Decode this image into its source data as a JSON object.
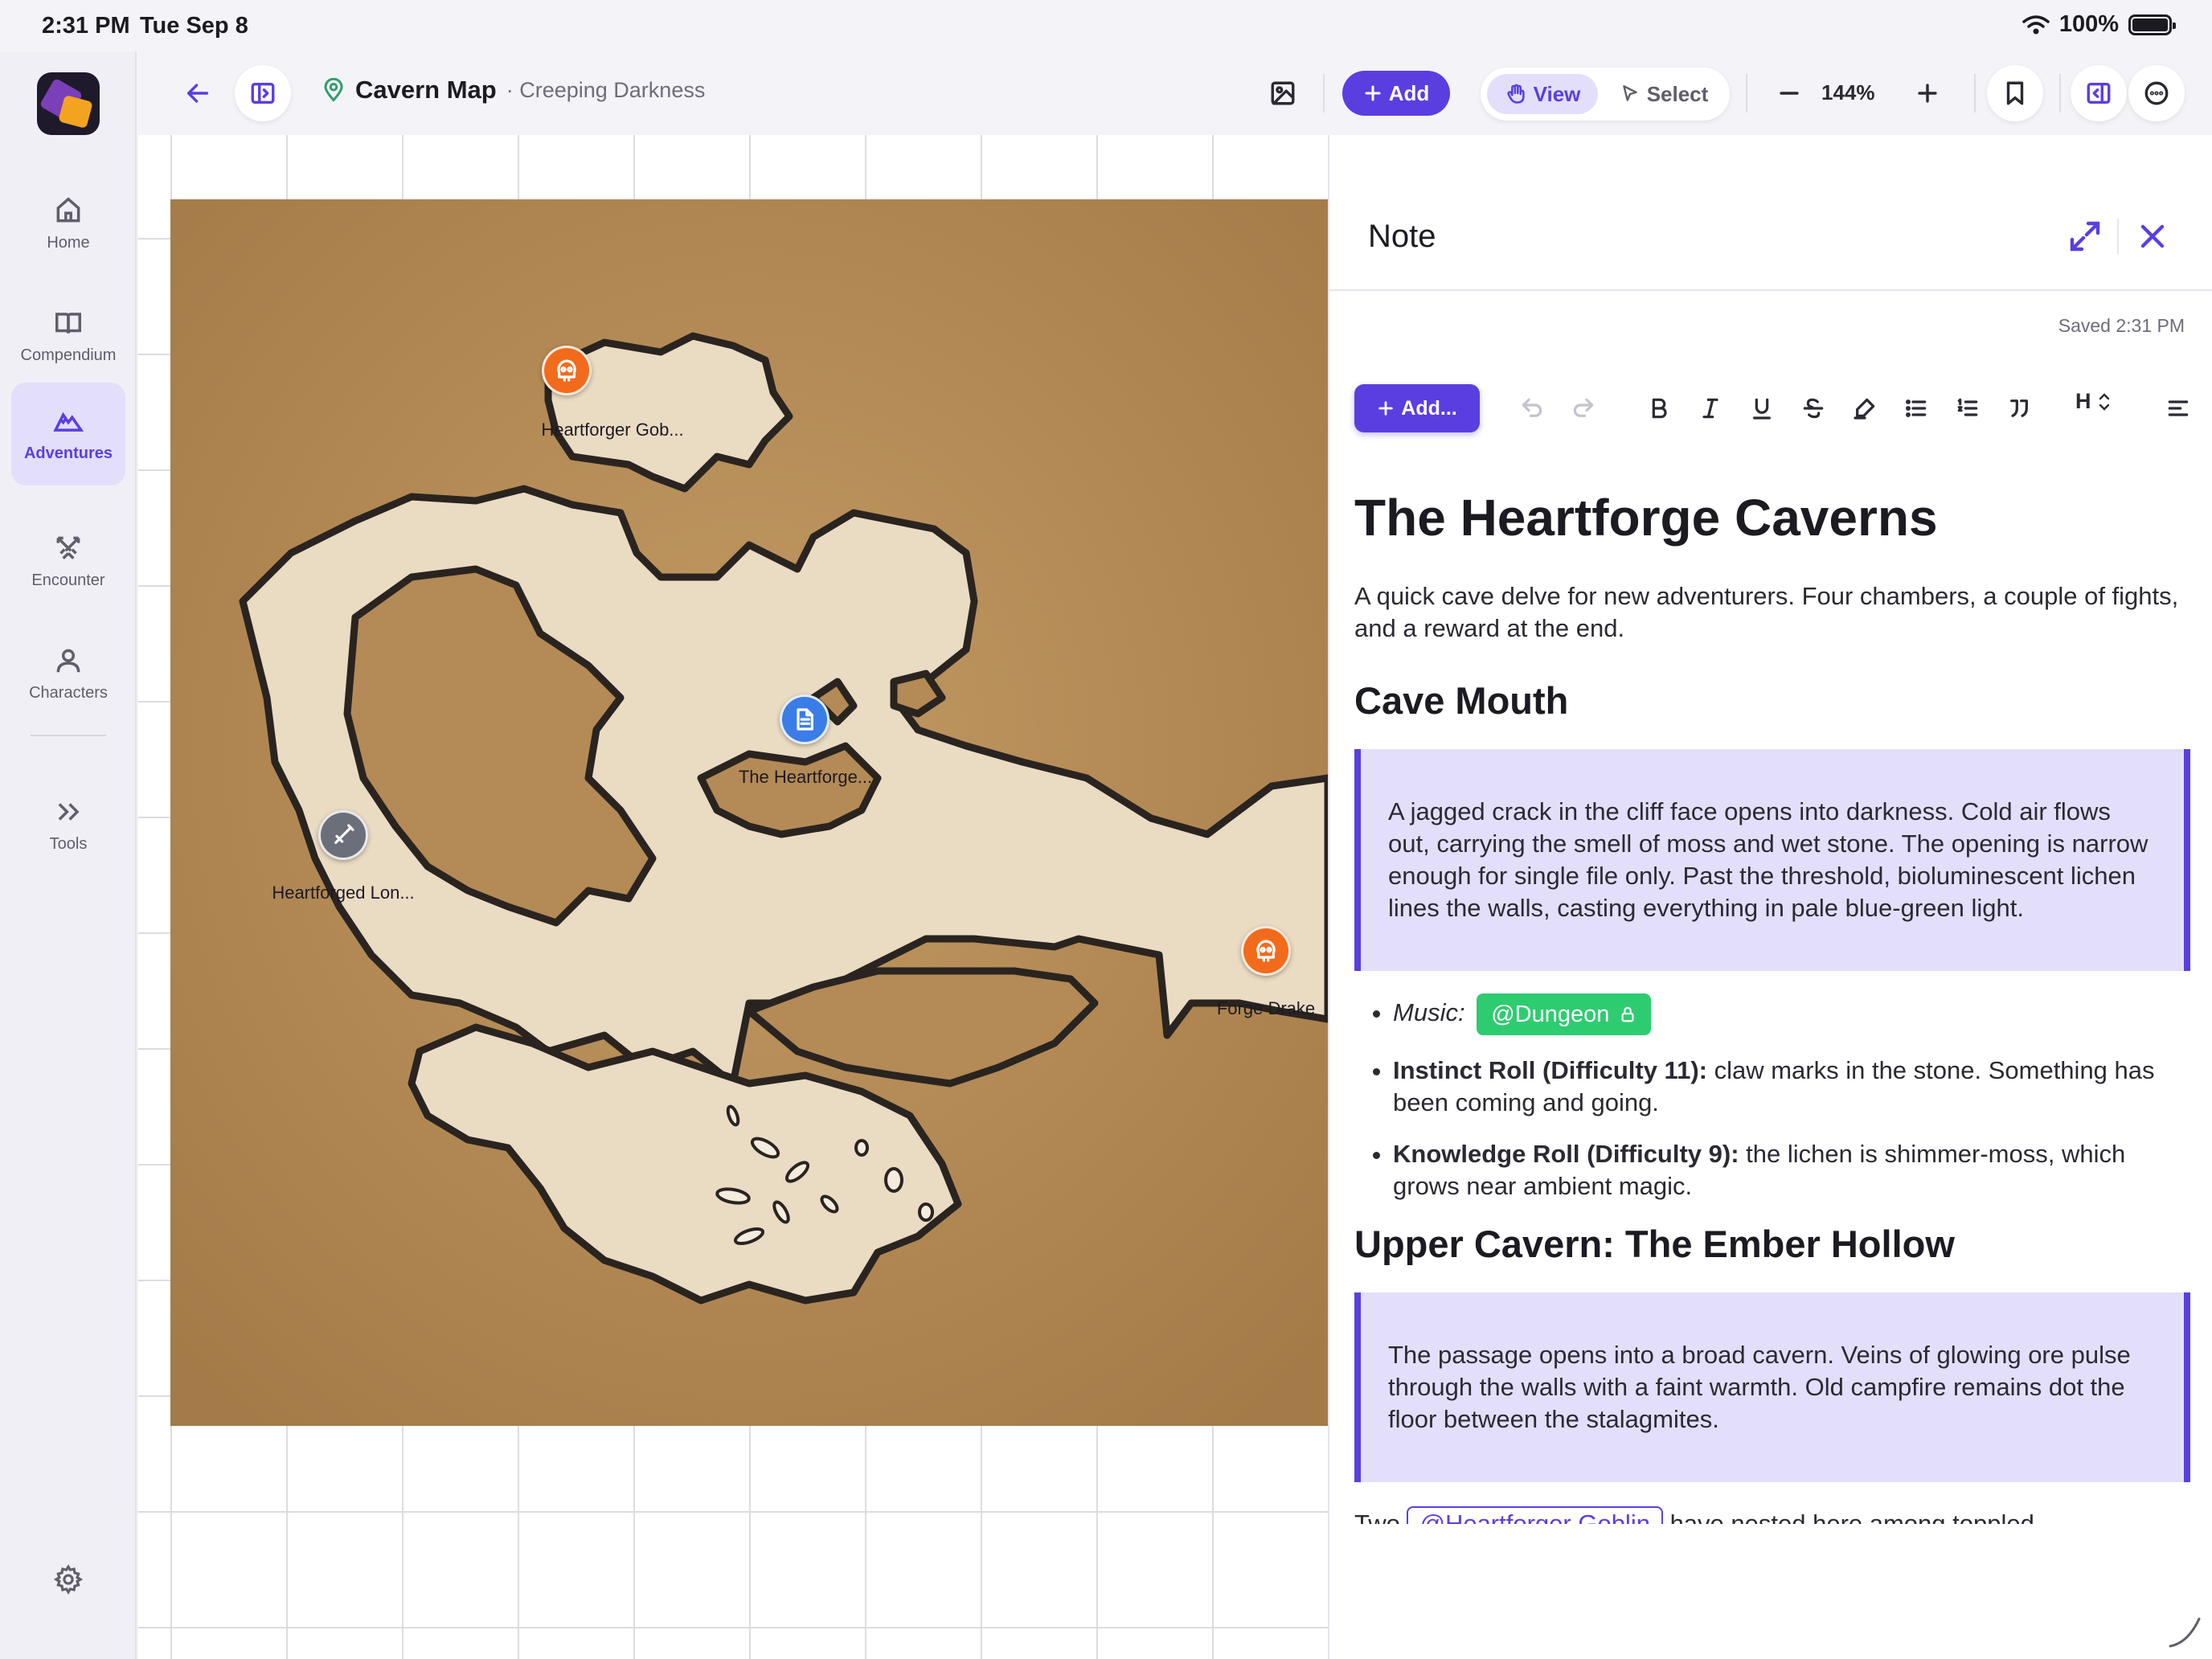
{
  "status_bar": {
    "time": "2:31 PM",
    "date": "Tue Sep 8",
    "battery": "100%"
  },
  "sidebar": {
    "items": [
      {
        "label": "Home",
        "icon": "home-icon"
      },
      {
        "label": "Compendium",
        "icon": "book-icon"
      },
      {
        "label": "Adventures",
        "icon": "mountain-icon",
        "active": true
      },
      {
        "label": "Encounter",
        "icon": "crossed-swords-icon"
      },
      {
        "label": "Characters",
        "icon": "person-icon"
      },
      {
        "label": "Tools",
        "icon": "chevrons-right-icon"
      }
    ]
  },
  "toolbar": {
    "title": "Cavern Map",
    "subtitle": "· Creeping Darkness",
    "add_label": "Add",
    "view_label": "View",
    "select_label": "Select",
    "zoom": "144%"
  },
  "map": {
    "pins": [
      {
        "label": "Heartforger Gob...",
        "type": "monster"
      },
      {
        "label": "The Heartforge...",
        "type": "note"
      },
      {
        "label": "Heartforged Lon...",
        "type": "item"
      },
      {
        "label": "Forge Drake",
        "type": "monster"
      }
    ]
  },
  "note": {
    "panel_title": "Note",
    "saved": "Saved 2:31 PM",
    "add_label": "Add...",
    "heading_menu": "H",
    "title": "The Heartforge Caverns",
    "intro": "A quick cave delve for new adventurers. Four chambers, a couple of fights, and a reward at the end.",
    "section1": {
      "heading": "Cave Mouth",
      "callout": "A jagged crack in the cliff face opens into darkness. Cold air flows out, carrying the smell of moss and wet stone. The opening is narrow enough for single file only. Past the threshold, bioluminescent lichen lines the walls, casting everything in pale blue-green light.",
      "music_label": "Music:",
      "music_tag": "@Dungeon",
      "bullet2_bold": "Instinct Roll (Difficulty 11):",
      "bullet2_text": " claw marks in the stone. Something has been coming and going.",
      "bullet3_bold": "Knowledge Roll (Difficulty 9):",
      "bullet3_text": " the lichen is shimmer-moss, which grows near ambient magic."
    },
    "section2": {
      "heading": "Upper Cavern: The Ember Hollow",
      "callout": "The passage opens into a broad cavern. Veins of glowing ore pulse through the walls with a faint warmth. Old campfire remains dot the floor between the stalagmites.",
      "tail_start": "Two ",
      "tail_mention": "@Heartforger Goblin",
      "tail_end": " have nested here among toppled"
    }
  },
  "colors": {
    "accent": "#5b3ee0",
    "accent_light": "#e3dffb",
    "tag_green": "#2ecc71",
    "pin_orange": "#f26b1d",
    "pin_blue": "#3a7de6"
  }
}
